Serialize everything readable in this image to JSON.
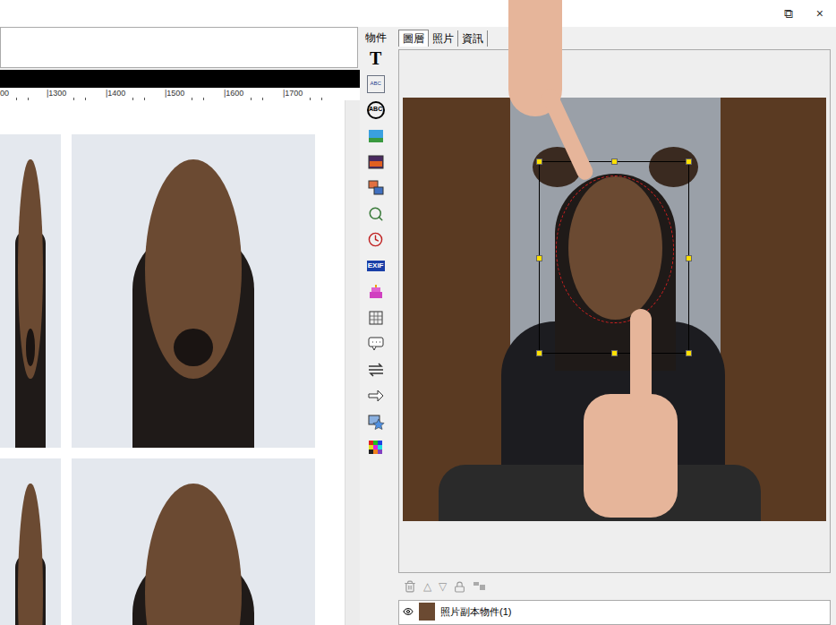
{
  "window": {
    "controls": [
      "⧉",
      "×"
    ]
  },
  "ruler": {
    "labels": [
      "00",
      "|1300",
      "|1400",
      "|1500",
      "|1600",
      "|1700"
    ]
  },
  "toolbar": {
    "title": "物件",
    "tools": [
      {
        "kind": "text",
        "label": "T"
      },
      {
        "kind": "textbox",
        "label": "ABC"
      },
      {
        "kind": "textcircle",
        "label": "ABC"
      },
      {
        "kind": "landscape"
      },
      {
        "kind": "sunset"
      },
      {
        "kind": "layers"
      },
      {
        "kind": "zoom"
      },
      {
        "kind": "clock"
      },
      {
        "kind": "exif",
        "label": "EXIF"
      },
      {
        "kind": "cake"
      },
      {
        "kind": "calendar"
      },
      {
        "kind": "speech"
      },
      {
        "kind": "swap"
      },
      {
        "kind": "arrow"
      },
      {
        "kind": "star"
      },
      {
        "kind": "palette"
      }
    ]
  },
  "tabs": [
    {
      "label": "圖層",
      "selected": true
    },
    {
      "label": "照片",
      "selected": false
    },
    {
      "label": "資訊",
      "selected": false
    }
  ],
  "layer_tools": [
    "△",
    "▽"
  ],
  "layers": [
    {
      "name": "照片副本物件(1)",
      "visible": true
    }
  ]
}
